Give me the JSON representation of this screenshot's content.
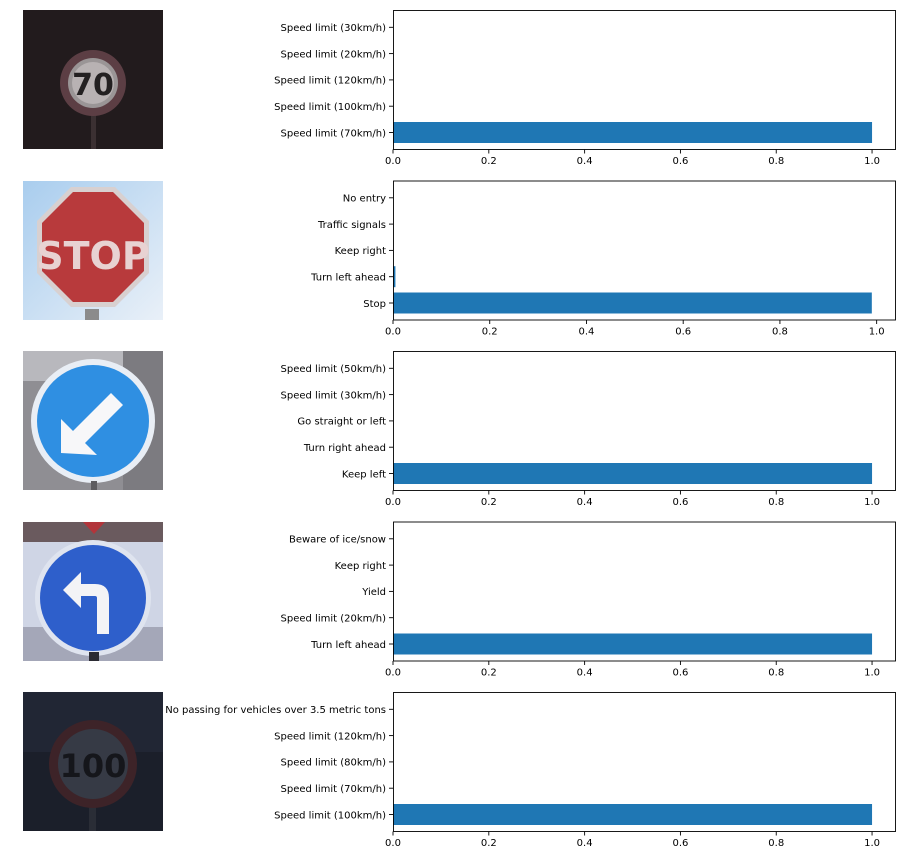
{
  "chart_data": [
    {
      "type": "bar",
      "orientation": "horizontal",
      "image_icon": "speed-limit-70-sign-icon",
      "categories": [
        "Speed limit (70km/h)",
        "Speed limit (100km/h)",
        "Speed limit (120km/h)",
        "Speed limit (20km/h)",
        "Speed limit (30km/h)"
      ],
      "values": [
        1.0,
        0.0,
        0.0,
        0.0,
        0.0
      ],
      "xlim": [
        0,
        1.05
      ],
      "xticks": [
        0.0,
        0.2,
        0.4,
        0.6,
        0.8,
        1.0
      ],
      "bar_color": "#1f77b4"
    },
    {
      "type": "bar",
      "orientation": "horizontal",
      "image_icon": "stop-sign-icon",
      "image_text": "STOP",
      "categories": [
        "Stop",
        "Turn left ahead",
        "Keep right",
        "Traffic signals",
        "No entry"
      ],
      "values": [
        0.99,
        0.005,
        0.0,
        0.0,
        0.0
      ],
      "xlim": [
        0,
        1.04
      ],
      "xticks": [
        0.0,
        0.2,
        0.4,
        0.6,
        0.8,
        1.0
      ],
      "bar_color": "#1f77b4"
    },
    {
      "type": "bar",
      "orientation": "horizontal",
      "image_icon": "keep-left-sign-icon",
      "categories": [
        "Keep left",
        "Turn right ahead",
        "Go straight or left",
        "Speed limit (30km/h)",
        "Speed limit (50km/h)"
      ],
      "values": [
        1.0,
        0.0,
        0.0,
        0.0,
        0.0
      ],
      "xlim": [
        0,
        1.05
      ],
      "xticks": [
        0.0,
        0.2,
        0.4,
        0.6,
        0.8,
        1.0
      ],
      "bar_color": "#1f77b4"
    },
    {
      "type": "bar",
      "orientation": "horizontal",
      "image_icon": "turn-left-ahead-sign-icon",
      "categories": [
        "Turn left ahead",
        "Speed limit (20km/h)",
        "Yield",
        "Keep right",
        "Beware of ice/snow"
      ],
      "values": [
        1.0,
        0.0,
        0.0,
        0.0,
        0.0
      ],
      "xlim": [
        0,
        1.05
      ],
      "xticks": [
        0.0,
        0.2,
        0.4,
        0.6,
        0.8,
        1.0
      ],
      "bar_color": "#1f77b4"
    },
    {
      "type": "bar",
      "orientation": "horizontal",
      "image_icon": "speed-limit-100-sign-icon",
      "categories": [
        "Speed limit (100km/h)",
        "Speed limit (70km/h)",
        "Speed limit (80km/h)",
        "Speed limit (120km/h)",
        "No passing for vehicles over 3.5 metric tons"
      ],
      "values": [
        1.0,
        0.0,
        0.0,
        0.0,
        0.0
      ],
      "xlim": [
        0,
        1.05
      ],
      "xticks": [
        0.0,
        0.2,
        0.4,
        0.6,
        0.8,
        1.0
      ],
      "bar_color": "#1f77b4"
    }
  ]
}
